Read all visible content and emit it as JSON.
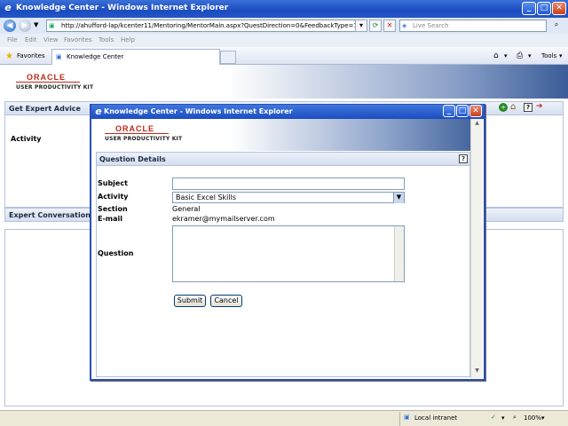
{
  "browser": {
    "title": "Knowledge Center - Windows Internet Explorer",
    "url": "http://ahufford-lap/kcenter11/Mentoring/MentorMain.aspx?QuestDirection=0&FeedbackType=1",
    "search_placeholder": "Live Search",
    "menu": [
      "File",
      "Edit",
      "View",
      "Favorites",
      "Tools",
      "Help"
    ],
    "favorites_label": "Favorites",
    "tab_label": "Knowledge Center",
    "tools_label": "Tools"
  },
  "page": {
    "logo": "ORACLE",
    "logo_sub": "USER PRODUCTIVITY KIT",
    "get_expert_advice": "Get Expert Advice",
    "activity_label": "Activity",
    "expert_conversation": "Expert Conversation"
  },
  "popup": {
    "title": "Knowledge Center - Windows Internet Explorer",
    "logo": "ORACLE",
    "logo_sub": "USER PRODUCTIVITY KIT",
    "section_title": "Question Details",
    "help": "?",
    "form": {
      "subject_label": "Subject",
      "subject_value": "",
      "activity_label": "Activity",
      "activity_value": "Basic Excel Skills",
      "section_label": "Section",
      "section_value": "General",
      "email_label": "E-mail",
      "email_value": "ekramer@mymailserver.com",
      "question_label": "Question",
      "question_value": ""
    },
    "submit": "Submit",
    "cancel": "Cancel"
  },
  "status": {
    "zone": "Local intranet",
    "zoom": "100%"
  }
}
